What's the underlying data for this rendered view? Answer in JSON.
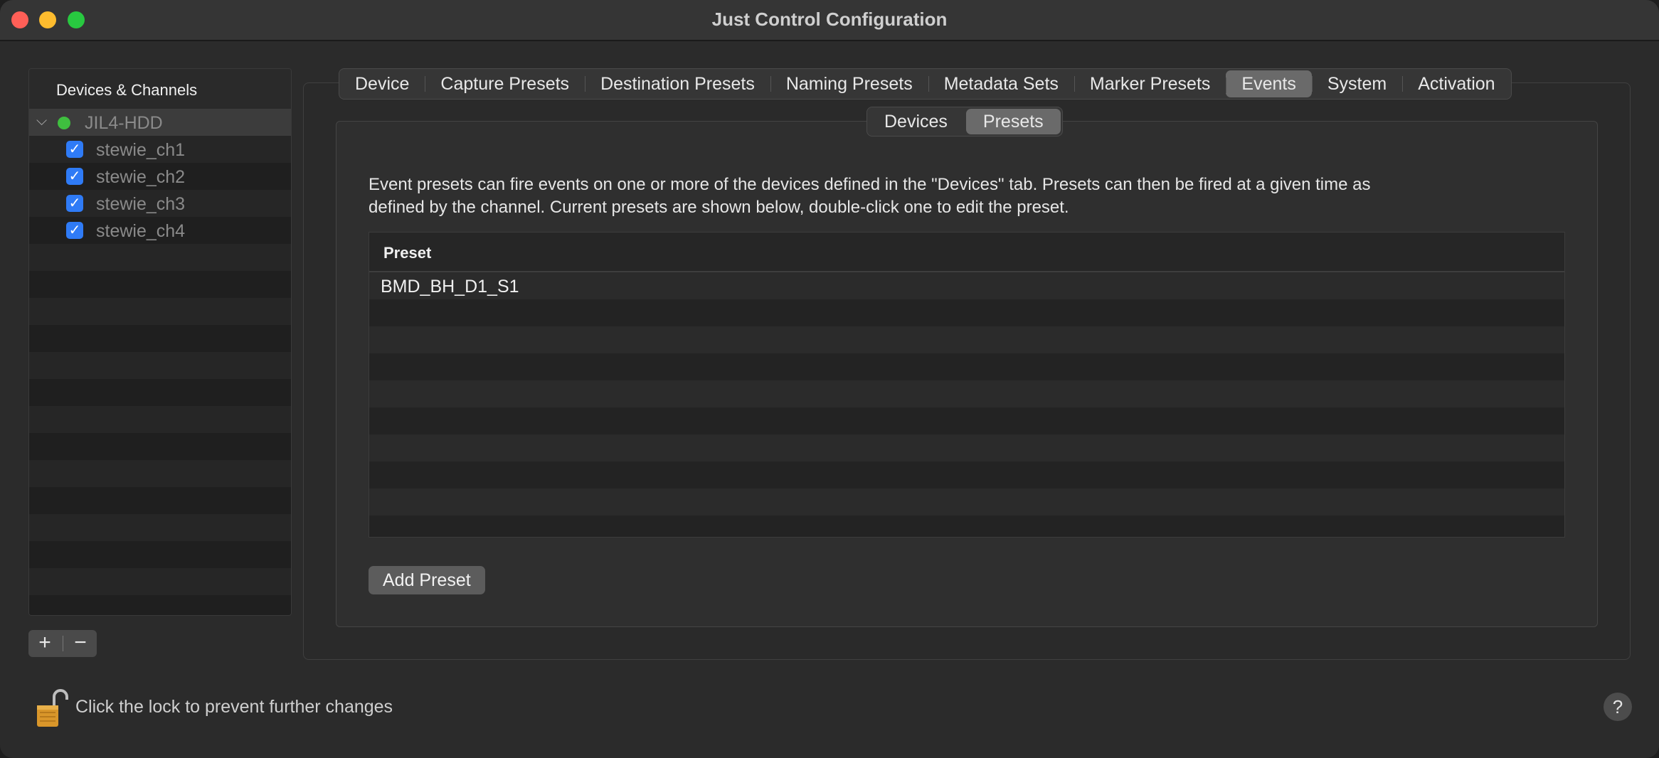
{
  "window": {
    "title": "Just Control Configuration"
  },
  "sidebar": {
    "header": "Devices & Channels",
    "device": {
      "name": "JIL4-HDD",
      "status": "online",
      "status_color": "#3fbf3f"
    },
    "channels": [
      {
        "label": "stewie_ch1",
        "checked": true
      },
      {
        "label": "stewie_ch2",
        "checked": true
      },
      {
        "label": "stewie_ch3",
        "checked": true
      },
      {
        "label": "stewie_ch4",
        "checked": true
      }
    ],
    "add_label": "+",
    "remove_label": "−"
  },
  "tabs": [
    {
      "label": "Device",
      "active": false
    },
    {
      "label": "Capture Presets",
      "active": false
    },
    {
      "label": "Destination Presets",
      "active": false
    },
    {
      "label": "Naming Presets",
      "active": false
    },
    {
      "label": "Metadata Sets",
      "active": false
    },
    {
      "label": "Marker Presets",
      "active": false
    },
    {
      "label": "Events",
      "active": true
    },
    {
      "label": "System",
      "active": false
    },
    {
      "label": "Activation",
      "active": false
    }
  ],
  "subtabs": [
    {
      "label": "Devices",
      "active": false
    },
    {
      "label": "Presets",
      "active": true
    }
  ],
  "main": {
    "description_line1": "Event presets can fire events on one or more of the devices defined in the \"Devices\" tab. Presets can then be fired at a given time as",
    "description_line2": "defined by the channel. Current presets are shown below, double-click one to edit the preset.",
    "table": {
      "column": "Preset",
      "rows": [
        "BMD_BH_D1_S1"
      ]
    },
    "add_button": "Add Preset"
  },
  "footer": {
    "lock_text": "Click the lock to prevent further changes",
    "help_label": "?"
  },
  "colors": {
    "accent": "#2f7bf6",
    "close": "#ff5f57",
    "minimize": "#febc2e",
    "maximize": "#28c840"
  }
}
